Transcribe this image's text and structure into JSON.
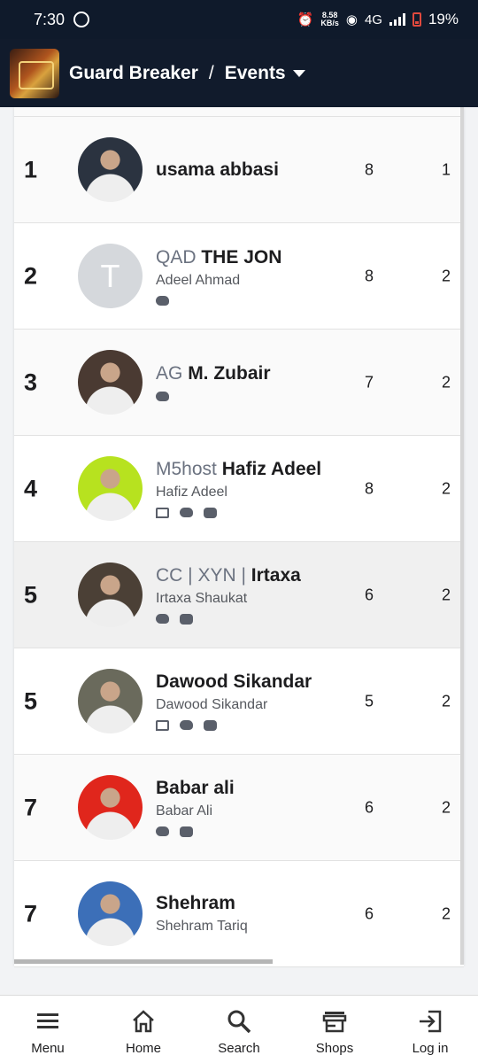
{
  "status_bar": {
    "time": "7:30",
    "net_speed_value": "8.58",
    "net_speed_unit": "KB/s",
    "network": "4G",
    "battery": "19%"
  },
  "header": {
    "app_name": "Guard Breaker",
    "separator": "/",
    "section": "Events"
  },
  "players": [
    {
      "rank": "1",
      "prefix": "",
      "name": "usama abbasi",
      "real_name": "",
      "socials": [],
      "stat1": "8",
      "stat2": "1",
      "avatar_color": "#2b3340",
      "avatar_letter": ""
    },
    {
      "rank": "2",
      "prefix": "QAD",
      "name": "THE JON",
      "real_name": "Adeel Ahmad",
      "socials": [
        "twitter"
      ],
      "stat1": "8",
      "stat2": "2",
      "avatar_color": "#d5d8dc",
      "avatar_letter": "T"
    },
    {
      "rank": "3",
      "prefix": "AG",
      "name": "M. Zubair",
      "real_name": "",
      "socials": [
        "twitter"
      ],
      "stat1": "7",
      "stat2": "2",
      "avatar_color": "#4a3a32",
      "avatar_letter": ""
    },
    {
      "rank": "4",
      "prefix": "M5host",
      "name": "Hafiz Adeel",
      "real_name": "Hafiz Adeel",
      "socials": [
        "twitch",
        "twitter",
        "discord"
      ],
      "stat1": "8",
      "stat2": "2",
      "avatar_color": "#b7e21f",
      "avatar_letter": ""
    },
    {
      "rank": "5",
      "prefix": "CC | XYN |",
      "name": "Irtaxa",
      "real_name": "Irtaxa Shaukat",
      "socials": [
        "twitter",
        "discord"
      ],
      "stat1": "6",
      "stat2": "2",
      "avatar_color": "#4b4036",
      "avatar_letter": ""
    },
    {
      "rank": "5",
      "prefix": "",
      "name": "Dawood Sikandar",
      "real_name": "Dawood Sikandar",
      "socials": [
        "twitch",
        "twitter",
        "discord"
      ],
      "stat1": "5",
      "stat2": "2",
      "avatar_color": "#6a6a5c",
      "avatar_letter": ""
    },
    {
      "rank": "7",
      "prefix": "",
      "name": "Babar ali",
      "real_name": "Babar Ali",
      "socials": [
        "twitter",
        "discord"
      ],
      "stat1": "6",
      "stat2": "2",
      "avatar_color": "#e0261c",
      "avatar_letter": ""
    },
    {
      "rank": "7",
      "prefix": "",
      "name": "Shehram",
      "real_name": "Shehram Tariq",
      "socials": [],
      "stat1": "6",
      "stat2": "2",
      "avatar_color": "#3c6fb8",
      "avatar_letter": ""
    }
  ],
  "bottom_nav": [
    {
      "label": "Menu",
      "icon": "menu-icon"
    },
    {
      "label": "Home",
      "icon": "home-icon"
    },
    {
      "label": "Search",
      "icon": "search-icon"
    },
    {
      "label": "Shops",
      "icon": "shops-icon"
    },
    {
      "label": "Log in",
      "icon": "login-icon"
    }
  ]
}
